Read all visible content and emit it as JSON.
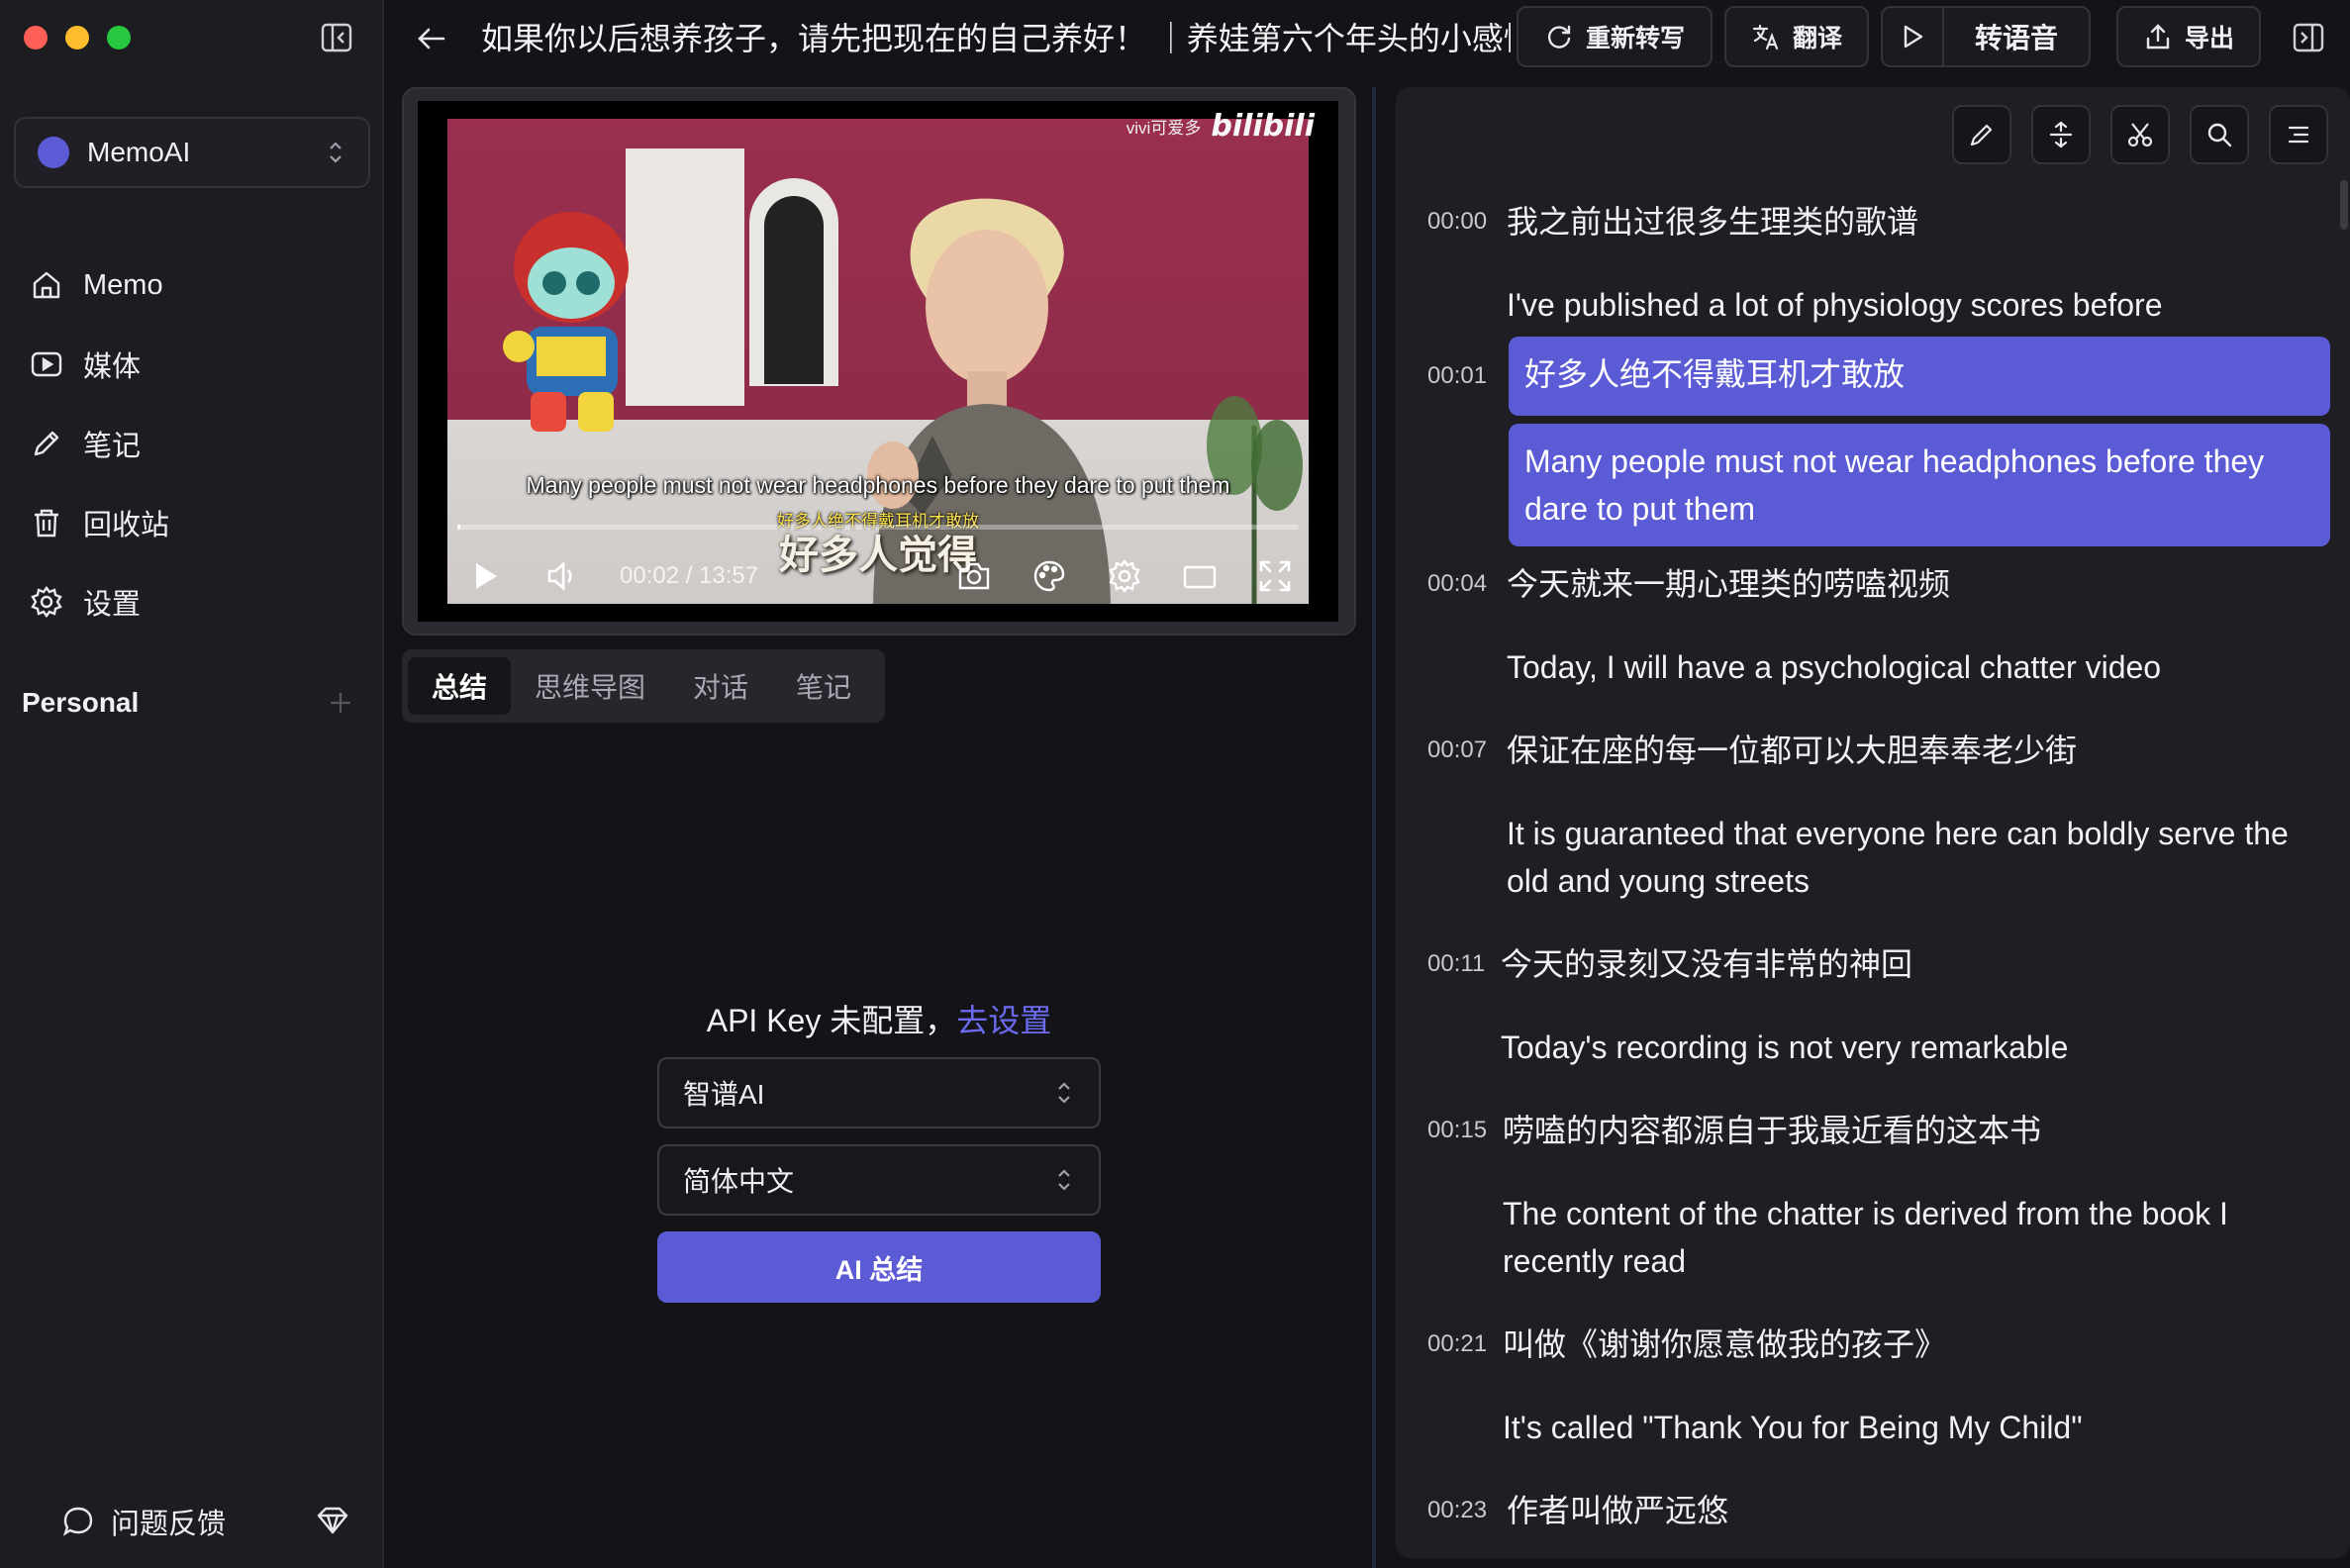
{
  "sidebar": {
    "workspace": "MemoAI",
    "nav": [
      {
        "label": "Memo",
        "icon": "home-icon"
      },
      {
        "label": "媒体",
        "icon": "media-icon"
      },
      {
        "label": "笔记",
        "icon": "pencil-icon"
      },
      {
        "label": "回收站",
        "icon": "trash-icon"
      },
      {
        "label": "设置",
        "icon": "gear-icon"
      }
    ],
    "section": "Personal",
    "feedback": "问题反馈"
  },
  "header": {
    "title": "如果你以后想养孩子，请先把现在的自己养好！ ｜养娃第六个年头的小感悟",
    "retranscribe": "重新转写",
    "translate": "翻译",
    "tts": "转语音",
    "export": "导出"
  },
  "video": {
    "watermark_user": "vivi可爱多",
    "watermark_logo": "bilibili",
    "subtitle_en": "Many people must not wear headphones before they dare to put them",
    "subtitle_cn_small": "好多人绝不得戴耳机才敢放",
    "subtitle_cn_big": "好多人觉得",
    "time": "00:02 / 13:57",
    "progress": 0.0025
  },
  "tabs": [
    "总结",
    "思维导图",
    "对话",
    "笔记"
  ],
  "summary": {
    "api_message": "API Key 未配置，",
    "api_link": "去设置",
    "model": "智谱AI",
    "language": "简体中文",
    "button": "AI 总结"
  },
  "transcript": [
    {
      "time": "00:00",
      "cn": "我之前出过很多生理类的歌谱",
      "en": "I've published a lot of physiology scores before",
      "active": false
    },
    {
      "time": "00:01",
      "cn": "好多人绝不得戴耳机才敢放",
      "en": "Many people must not wear headphones before they dare to put them",
      "active": true
    },
    {
      "time": "00:04",
      "cn": "今天就来一期心理类的唠嗑视频",
      "en": "Today, I will have a psychological chatter video",
      "active": false
    },
    {
      "time": "00:07",
      "cn": "保证在座的每一位都可以大胆奉奉老少街",
      "en": "It is guaranteed that everyone here can boldly serve the old and young streets",
      "active": false
    },
    {
      "time": "00:11",
      "cn": "今天的录刻又没有非常的神回",
      "en": "Today's recording is not very remarkable",
      "active": false
    },
    {
      "time": "00:15",
      "cn": "唠嗑的内容都源自于我最近看的这本书",
      "en": "The content of the chatter is derived from the book I recently read",
      "active": false
    },
    {
      "time": "00:21",
      "cn": "叫做《谢谢你愿意做我的孩子》",
      "en": "It's called \"Thank You for Being My Child\"",
      "active": false
    },
    {
      "time": "00:23",
      "cn": "作者叫做严远悠",
      "en": "",
      "active": false
    }
  ],
  "colors": {
    "accent": "#5b5bd6",
    "link": "#6b6bf0",
    "background": "#141418"
  }
}
